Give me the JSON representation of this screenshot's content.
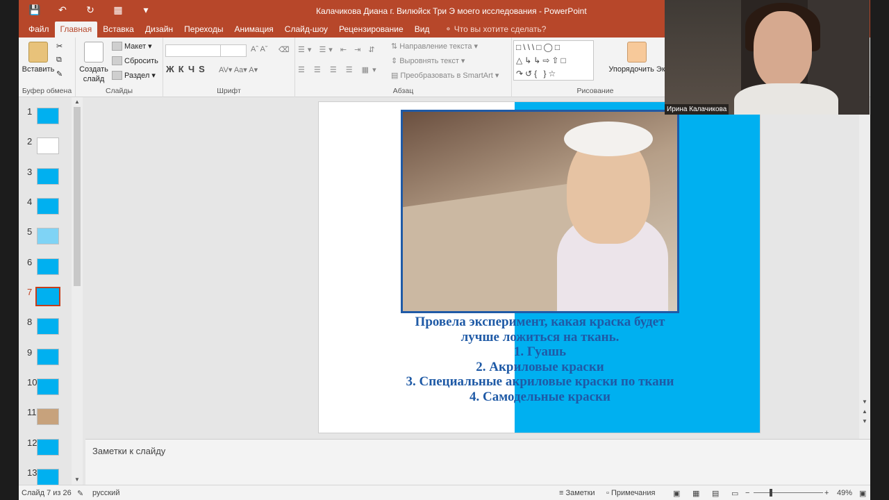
{
  "window": {
    "title": "Калачикова Диана г. Вилюйск Три Э моего исследования - PowerPoint"
  },
  "tabs": [
    {
      "label": "Файл",
      "active": false
    },
    {
      "label": "Главная",
      "active": true
    },
    {
      "label": "Вставка",
      "active": false
    },
    {
      "label": "Дизайн",
      "active": false
    },
    {
      "label": "Переходы",
      "active": false
    },
    {
      "label": "Анимация",
      "active": false
    },
    {
      "label": "Слайд-шоу",
      "active": false
    },
    {
      "label": "Рецензирование",
      "active": false
    },
    {
      "label": "Вид",
      "active": false
    }
  ],
  "search": {
    "placeholder": "Что вы хотите сделать?"
  },
  "ribbon": {
    "clipboard": {
      "paste": "Вставить",
      "group": "Буфер обмена"
    },
    "slides": {
      "create": "Создать",
      "create2": "слайд",
      "layout": "Макет",
      "reset": "Сбросить",
      "section": "Раздел",
      "group": "Слайды"
    },
    "font": {
      "group": "Шрифт",
      "format_icons": "ЖКЧS"
    },
    "paragraph": {
      "direction": "Направление текста",
      "align": "Выровнять текст",
      "smartart": "Преобразовать в SmartArt",
      "group": "Абзац"
    },
    "drawing": {
      "arrange": "Упорядочить",
      "arrange_tail": "Эк",
      "group": "Рисование"
    }
  },
  "thumbnails": [
    {
      "num": "1",
      "color": "#00b0f0"
    },
    {
      "num": "2",
      "color": "#ffffff"
    },
    {
      "num": "3",
      "color": "#00b0f0"
    },
    {
      "num": "4",
      "color": "#00b0f0"
    },
    {
      "num": "5",
      "color": "#7fd3f5"
    },
    {
      "num": "6",
      "color": "#00b0f0"
    },
    {
      "num": "7",
      "color": "#00b0f0",
      "selected": true
    },
    {
      "num": "8",
      "color": "#00b0f0"
    },
    {
      "num": "9",
      "color": "#00b0f0"
    },
    {
      "num": "10",
      "color": "#00b0f0"
    },
    {
      "num": "11",
      "color": "#c7a27c"
    },
    {
      "num": "12",
      "color": "#00b0f0"
    },
    {
      "num": "13",
      "color": "#00b0f0"
    }
  ],
  "slide": {
    "lines": [
      "Провела эксперимент, какая краска будет",
      "лучше ложиться на ткань.",
      "1. Гуашь",
      "2. Акриловые краски",
      "3. Специальные акриловые краски по ткани",
      "4. Самодельные краски"
    ]
  },
  "notes": {
    "placeholder": "Заметки к слайду"
  },
  "status": {
    "slide_count": "Слайд 7 из 26",
    "language": "русский",
    "notes_btn": "Заметки",
    "comments_btn": "Примечания",
    "zoom": "49%"
  },
  "webcam": {
    "name": "Ирина Калачикова"
  },
  "colors": {
    "accent": "#b7472a",
    "slide_blue": "#00b0f0",
    "text_blue": "#1f5aa6"
  }
}
